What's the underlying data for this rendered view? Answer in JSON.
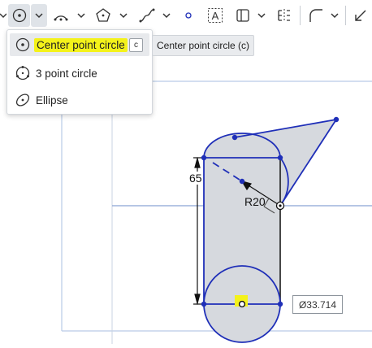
{
  "toolbar": {
    "items": [
      {
        "name": "arrow-partial-icon"
      },
      {
        "name": "center-point-circle-icon",
        "active": true
      },
      {
        "name": "chevron-down-icon"
      },
      {
        "name": "arc-icon"
      },
      {
        "name": "chevron-down-icon"
      },
      {
        "name": "polygon-icon"
      },
      {
        "name": "chevron-down-icon"
      },
      {
        "name": "spline-icon"
      },
      {
        "name": "chevron-down-icon"
      },
      {
        "name": "point-icon"
      },
      {
        "name": "text-icon"
      },
      {
        "name": "use-icon"
      },
      {
        "name": "chevron-down-icon"
      },
      {
        "name": "mirror-icon"
      },
      {
        "name": "fillet-icon"
      },
      {
        "name": "chevron-down-icon"
      },
      {
        "name": "trim-icon"
      }
    ]
  },
  "menu": {
    "items": [
      {
        "label": "Center point circle",
        "icon": "center-point-circle-icon",
        "shortcut": "c",
        "selected": true
      },
      {
        "label": "3 point circle",
        "icon": "three-point-circle-icon"
      },
      {
        "label": "Ellipse",
        "icon": "ellipse-icon"
      }
    ]
  },
  "tooltip": {
    "text": "Center point circle (c)"
  },
  "sketch": {
    "vertical_dimension": "65",
    "radius_dimension": "R20",
    "diameter_input": "Ø33.714"
  },
  "colors": {
    "sketch_line": "#1f2fb8",
    "region_fill": "#d6d9de",
    "grid_line": "#b9cbe6",
    "highlight": "#f4f21a"
  }
}
